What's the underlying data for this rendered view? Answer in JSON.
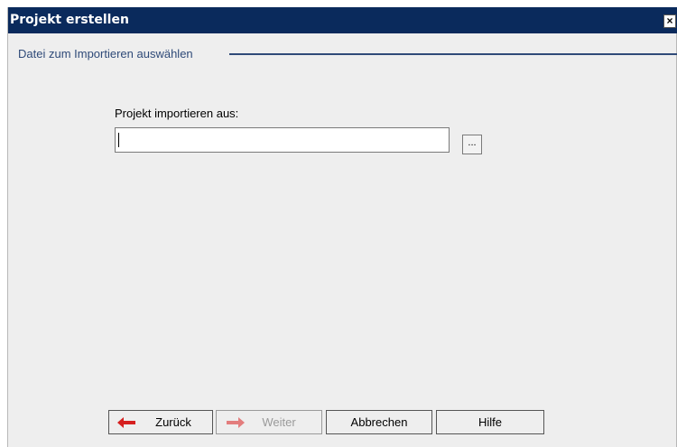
{
  "window": {
    "title": "Projekt erstellen",
    "close_label": "×"
  },
  "section": {
    "title": "Datei zum Importieren auswählen"
  },
  "import": {
    "label": "Projekt importieren aus:",
    "value": "",
    "browse_label": "..."
  },
  "buttons": {
    "back_label": "Zurück",
    "next_label": "Weiter",
    "cancel_label": "Abbrechen",
    "help_label": "Hilfe"
  },
  "colors": {
    "titlebar": "#0a2a5c",
    "section_line": "#2f4a78",
    "back_arrow": "#d62020",
    "next_arrow_disabled": "#e06060"
  }
}
